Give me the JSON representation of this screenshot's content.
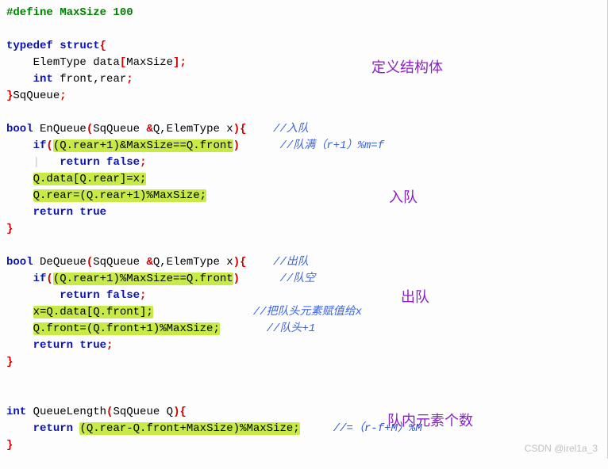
{
  "code": {
    "l1_define": "#define MaxSize 100",
    "typedef": "typedef struct",
    "field1a": "ElemType data",
    "field1b": "MaxSize",
    "field2": "int",
    "field2b": " front,rear",
    "struct_close": "SqQueue",
    "enq_ret": "bool",
    "enq_name": " EnQueue",
    "enq_params_a": "SqQueue ",
    "enq_params_amp": "&",
    "enq_params_b": "Q,ElemType x",
    "enq_cmt": "//入队",
    "enq_if": "if",
    "enq_if_body": "(Q.rear+1)&MaxSize==Q.front",
    "enq_if_cmt": "//队满（r+1）%m=f",
    "ret_false": "return false",
    "enq_assign": "Q.data[Q.rear]=x;",
    "enq_rear": "Q.rear=(Q.rear+1)%MaxSize;",
    "ret_true": "return true",
    "deq_ret": "bool",
    "deq_name": " DeQueue",
    "deq_params_a": "SqQueue ",
    "deq_params_b": "Q,ElemType x",
    "deq_cmt": "//出队",
    "deq_if_body": "(Q.rear+1)%MaxSize==Q.front",
    "deq_if_cmt": "//队空",
    "deq_assign": "x=Q.data[Q.front];",
    "deq_assign_cmt": "//把队头元素赋值给x",
    "deq_front": "Q.front=(Q.front+1)%MaxSize;",
    "deq_front_cmt": "//队头+1",
    "ret_true2": "return true",
    "ql_ret": "int",
    "ql_name": " QueueLength",
    "ql_params": "SqQueue Q",
    "ql_ret_kw": "return",
    "ql_body": "(Q.rear-Q.front+MaxSize)%MaxSize;",
    "ql_cmt": "//=（r-f+M）%M"
  },
  "annotations": {
    "struct": "定义结构体",
    "enqueue": "入队",
    "dequeue": "出队",
    "length": "队内元素个数"
  },
  "watermark": "CSDN @irel1a_3"
}
